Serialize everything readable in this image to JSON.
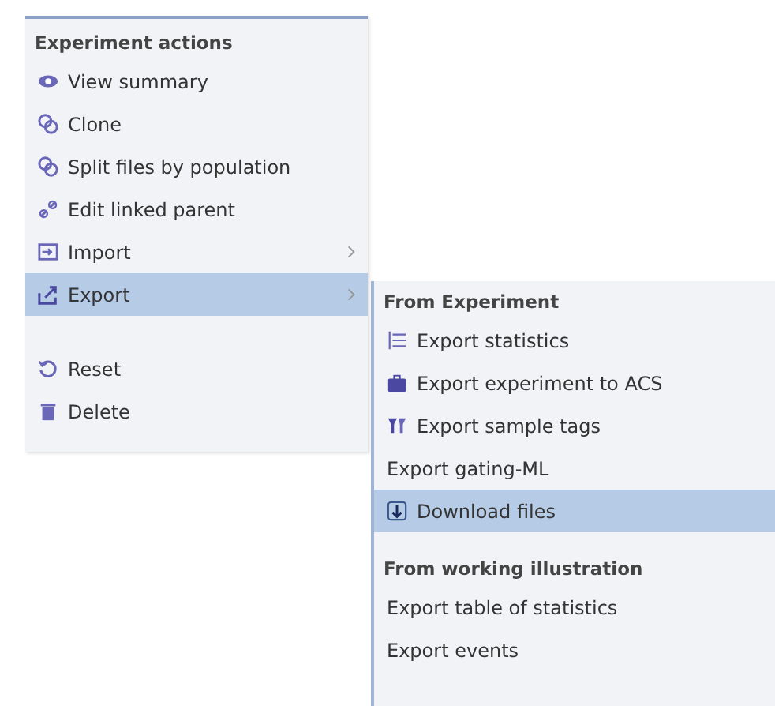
{
  "menu": {
    "title": "Experiment actions",
    "groups": [
      [
        {
          "label": "View summary",
          "selected": false,
          "has_submenu": false
        },
        {
          "label": "Clone",
          "selected": false,
          "has_submenu": false
        },
        {
          "label": "Split files by population",
          "selected": false,
          "has_submenu": false
        },
        {
          "label": "Edit linked parent",
          "selected": false,
          "has_submenu": false
        },
        {
          "label": "Import",
          "selected": false,
          "has_submenu": true
        },
        {
          "label": "Export",
          "selected": true,
          "has_submenu": true
        }
      ],
      [
        {
          "label": "Reset",
          "selected": false,
          "has_submenu": false
        },
        {
          "label": "Delete",
          "selected": false,
          "has_submenu": false
        }
      ]
    ]
  },
  "submenu": {
    "sections": [
      {
        "title": "From Experiment",
        "items": [
          {
            "label": "Export statistics",
            "selected": false
          },
          {
            "label": "Export experiment to ACS",
            "selected": false
          },
          {
            "label": "Export sample tags",
            "selected": false
          },
          {
            "label": "Export gating-ML",
            "selected": false
          },
          {
            "label": "Download files",
            "selected": true
          }
        ]
      },
      {
        "title": "From working illustration",
        "items": [
          {
            "label": "Export table of statistics",
            "selected": false
          },
          {
            "label": "Export events",
            "selected": false
          }
        ]
      }
    ]
  }
}
